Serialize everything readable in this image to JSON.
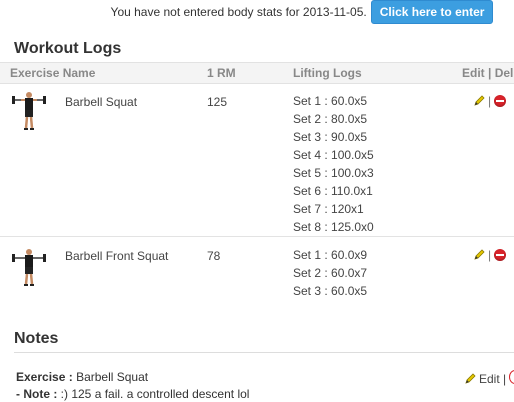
{
  "banner": {
    "message": "You have not entered body stats for 2013-11-05.",
    "button_label": "Click here to enter"
  },
  "workout_logs": {
    "title": "Workout Logs",
    "columns": {
      "exercise": "Exercise Name",
      "one_rm": "1 RM",
      "lifting_logs": "Lifting Logs",
      "edit_del": "Edit | Del"
    },
    "rows": [
      {
        "exercise": "Barbell Squat",
        "one_rm": "125",
        "sets": [
          "Set 1 : 60.0x5",
          "Set 2 : 80.0x5",
          "Set 3 : 90.0x5",
          "Set 4 : 100.0x5",
          "Set 5 : 100.0x3",
          "Set 6 : 110.0x1",
          "Set 7 : 120x1",
          "Set 8 : 125.0x0"
        ]
      },
      {
        "exercise": "Barbell Front Squat",
        "one_rm": "78",
        "sets": [
          "Set 1 : 60.0x9",
          "Set 2 : 60.0x7",
          "Set 3 : 60.0x5"
        ]
      }
    ]
  },
  "notes": {
    "title": "Notes",
    "exercise_label": "Exercise :",
    "exercise_value": "Barbell Squat",
    "note_label": "- Note :",
    "note_value": ":) 125 a fail. a controlled descent lol",
    "edit_label": "Edit |"
  },
  "icons": {
    "edit": "pencil-icon",
    "delete": "delete-icon",
    "exercise_thumb": "squat-figure-icon"
  },
  "colors": {
    "button": "#3c9ee0",
    "delete": "#d9232a",
    "pencil": "#e6c800"
  }
}
